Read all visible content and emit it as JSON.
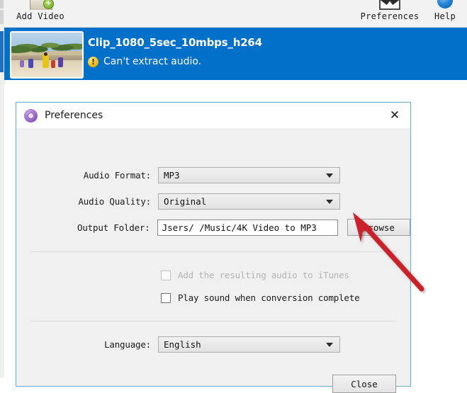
{
  "toolbar": {
    "add_video": {
      "label": "Add Video",
      "icon": "folder-add-icon"
    },
    "preferences": {
      "label": "Preferences",
      "icon": "preferences-icon"
    },
    "help": {
      "label": "Help",
      "icon": "help-icon"
    }
  },
  "video_row": {
    "title": "Clip_1080_5sec_10mbps_h264",
    "status_text": "Can't extract audio.",
    "status_icon": "warning-icon",
    "selected_color": "#0070c9",
    "thumbnail_alt": "beach-scene-thumbnail"
  },
  "dialog": {
    "title": "Preferences",
    "app_icon": "app-logo-icon",
    "close_icon": "✕",
    "fields": {
      "audio_format": {
        "label": "Audio Format:",
        "value": "MP3"
      },
      "audio_quality": {
        "label": "Audio Quality:",
        "value": "Original"
      },
      "output_folder": {
        "label": "Output Folder:",
        "value": "Jsers/          /Music/4K Video to MP3",
        "browse_label": "Browse"
      },
      "language": {
        "label": "Language:",
        "value": "English"
      }
    },
    "checkboxes": [
      {
        "label": "Add the resulting audio to iTunes",
        "checked": false,
        "disabled": true
      },
      {
        "label": "Play sound when conversion complete",
        "checked": false,
        "disabled": false
      }
    ],
    "close_button": "Close",
    "border_color": "#6aaed6"
  },
  "annotation": {
    "type": "arrow",
    "color": "#c9232a",
    "points_to": "browse-button"
  }
}
